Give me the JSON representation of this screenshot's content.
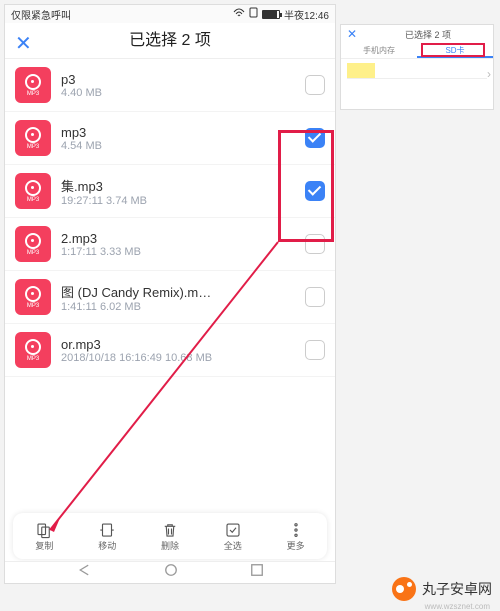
{
  "status": {
    "left": "仅限紧急呼叫",
    "time": "半夜12:46"
  },
  "header": {
    "title": "已选择 2 项"
  },
  "files": [
    {
      "name": "p3",
      "meta": "4.40 MB",
      "checked": false
    },
    {
      "name": "mp3",
      "meta": "4.54 MB",
      "checked": true
    },
    {
      "name": "集.mp3",
      "meta": "19:27:11 3.74 MB",
      "checked": true
    },
    {
      "name": "2.mp3",
      "meta": "1:17:11 3.33 MB",
      "checked": false
    },
    {
      "name": "图 (DJ Candy Remix).m…",
      "meta": "1:41:11 6.02 MB",
      "checked": false
    },
    {
      "name": "or.mp3",
      "meta": "2018/10/18 16:16:49 10.68 MB",
      "checked": false
    }
  ],
  "thumb_label": "MP3",
  "actions": {
    "copy": "复制",
    "move": "移动",
    "delete": "删除",
    "select_all": "全选",
    "more": "更多"
  },
  "inset": {
    "title": "已选择 2 项",
    "tab1": "手机内存",
    "tab2": "SD卡"
  },
  "brand": {
    "name": "丸子安卓网",
    "url": "www.wzsznet.com"
  }
}
